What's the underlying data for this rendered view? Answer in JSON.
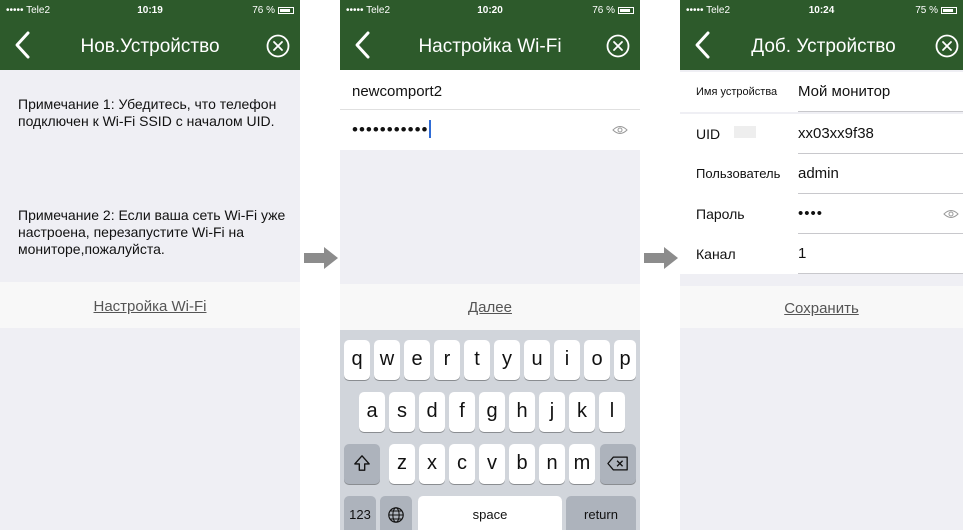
{
  "status_bars": [
    {
      "carrier": "••••• Tele2",
      "time": "10:19",
      "battery": "76 %"
    },
    {
      "carrier": "••••• Tele2",
      "time": "10:20",
      "battery": "76 %"
    },
    {
      "carrier": "••••• Tele2",
      "time": "10:24",
      "battery": "75 %"
    }
  ],
  "screen1": {
    "title": "Нов.Устройство",
    "note1": "Примечание 1: Убедитесь, что телефон подключен к Wi-Fi SSID с началом UID.",
    "note2": "Примечание 2: Если ваша сеть Wi-Fi уже настроена, перезапустите Wi-Fi на мониторе,пожалуйста.",
    "link": "Настройка Wi-Fi"
  },
  "screen2": {
    "title": "Настройка Wi-Fi",
    "ssid": "newcomport2",
    "password": "•••••••••••",
    "next": "Далее",
    "keyboard": {
      "row1": [
        "q",
        "w",
        "e",
        "r",
        "t",
        "y",
        "u",
        "i",
        "o",
        "p"
      ],
      "row2": [
        "a",
        "s",
        "d",
        "f",
        "g",
        "h",
        "j",
        "k",
        "l"
      ],
      "row3": [
        "z",
        "x",
        "c",
        "v",
        "b",
        "n",
        "m"
      ],
      "numbers": "123",
      "space": "space",
      "return": "return"
    }
  },
  "screen3": {
    "title": "Доб. Устройство",
    "fields": [
      {
        "label": "Имя устройства",
        "value": "Мой монитор"
      },
      {
        "label": "UID",
        "value": "xx03xx9f38"
      },
      {
        "label": "Пользователь",
        "value": "admin"
      },
      {
        "label": "Пароль",
        "value": "••••"
      },
      {
        "label": "Канал",
        "value": "1"
      }
    ],
    "save": "Сохранить"
  },
  "colors": {
    "header": "#2d5a2b",
    "background": "#efeff4",
    "keyboard": "#d1d5db"
  }
}
